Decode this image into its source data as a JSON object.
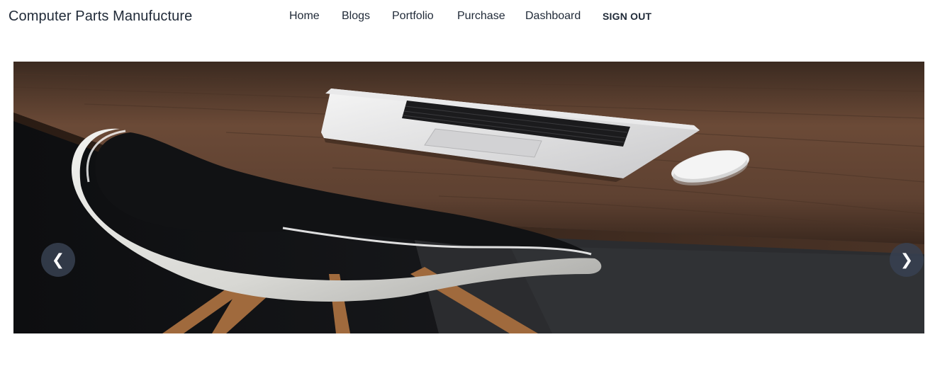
{
  "brand": {
    "title": "Computer Parts Manufucture"
  },
  "nav": {
    "items": [
      {
        "label": "Home"
      },
      {
        "label": "Blogs"
      },
      {
        "label": "Portfolio"
      },
      {
        "label": "Purchase"
      },
      {
        "label": "Dashboard"
      }
    ],
    "signout_label": "SIGN OUT"
  },
  "carousel": {
    "prev_icon": "chevron-left-icon",
    "next_icon": "chevron-right-icon",
    "prev_glyph": "❮",
    "next_glyph": "❯",
    "slide_description_icon": "desk-laptop-chair-photo"
  },
  "colors": {
    "text": "#1f2937",
    "carousel_button_bg": "#374151"
  }
}
